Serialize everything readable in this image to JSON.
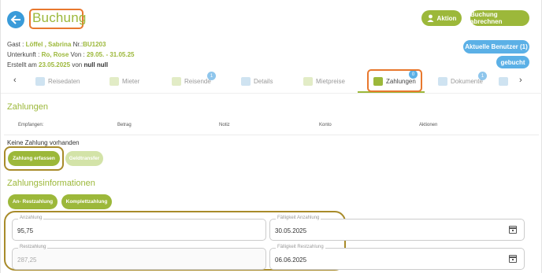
{
  "header": {
    "title": "Buchung",
    "action_label": "Aktion",
    "abrechnen_label": "Buchung abrechnen",
    "benutzer_label": "Aktuelle Benutzer (1)",
    "status_label": "gebucht"
  },
  "info": {
    "gast_label": "Gast :",
    "gast_value": "Löffel , Sabrina",
    "nr_label": "Nr.:",
    "nr_value": "BU1203",
    "unterkunft_label": "Unterkunft :",
    "unterkunft_value": "Ro, Rose",
    "von_label": "Von :",
    "von_value": "29.05. - 31.05.25",
    "erstellt_label": "Erstellt am",
    "erstellt_value": "23.05.2025",
    "von2_label": "von",
    "von2_value": "null null"
  },
  "tabs": [
    {
      "label": "Reisedaten",
      "icon": "chart-icon"
    },
    {
      "label": "Mieter",
      "icon": "grid-icon"
    },
    {
      "label": "Reisende",
      "icon": "people-icon",
      "badge": "1"
    },
    {
      "label": "Details",
      "icon": "list-icon"
    },
    {
      "label": "Mietpreise",
      "icon": "table-icon"
    },
    {
      "label": "Zahlungen",
      "icon": "money-icon",
      "badge": "0"
    },
    {
      "label": "Dokumente",
      "icon": "document-icon",
      "badge": "1"
    }
  ],
  "payments": {
    "section_title": "Zahlungen",
    "columns": [
      "Empfangen:",
      "Betrag",
      "Notiz",
      "Konto",
      "Aktionen"
    ],
    "empty_text": "Keine Zahlung vorhanden",
    "create_label": "Zahlung erfassen",
    "transfer_label": "Geldtransfer"
  },
  "payment_info": {
    "section_title": "Zahlungsinformationen",
    "btn_an_rest": "An- Restzahlung",
    "btn_komplett": "Komplettzahlung",
    "anzahlung_label": "Anzahlung",
    "anzahlung_value": "95,75",
    "faelligkeit_anzahlung_label": "Fälligkeit Anzahlung",
    "faelligkeit_anzahlung_value": "30.05.2025",
    "restzahlung_label": "Restzahlung",
    "restzahlung_value": "287,25",
    "faelligkeit_rest_label": "Fälligkeit Restzahlung",
    "faelligkeit_rest_value": "06.06.2025"
  },
  "colors": {
    "accent_green": "#9cb83a",
    "accent_blue": "#5bb0e6",
    "highlight_orange": "#e8782e",
    "highlight_olive": "#a88b2a"
  }
}
